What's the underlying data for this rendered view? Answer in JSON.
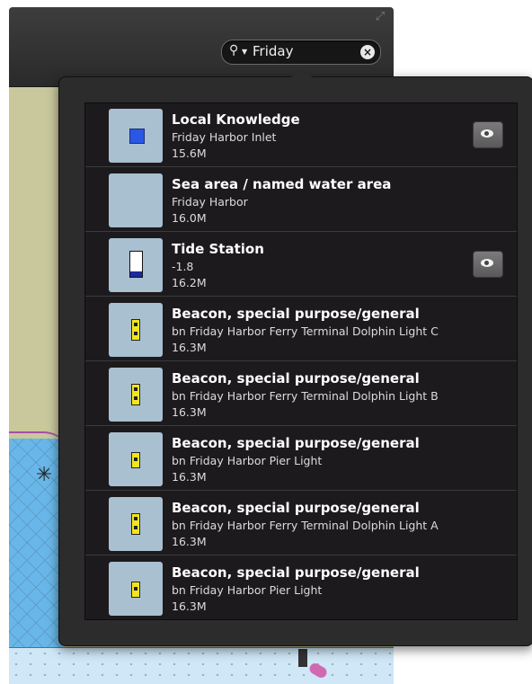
{
  "search": {
    "value": "Friday",
    "clear_icon": "clear-icon",
    "search_icon": "magnifier-icon"
  },
  "colors": {
    "popover_bg": "#2c2c2c",
    "list_bg": "#1d1a1d",
    "thumb_bg": "#a8c0d0",
    "beacon_yellow": "#f3e51d",
    "local_knowledge_blue": "#2a57e6"
  },
  "results": [
    {
      "title": "Local Knowledge",
      "subtitle": "Friday Harbor Inlet",
      "distance": "15.6M",
      "symbol": "blue-square-icon",
      "has_view_button": true
    },
    {
      "title": "Sea area / named water area",
      "subtitle": "Friday Harbor",
      "distance": "16.0M",
      "symbol": "blank",
      "has_view_button": false
    },
    {
      "title": "Tide Station",
      "subtitle": "-1.8",
      "distance": "16.2M",
      "symbol": "tide-gauge-icon",
      "has_view_button": true
    },
    {
      "title": "Beacon, special purpose/general",
      "subtitle": "bn Friday Harbor Ferry Terminal Dolphin Light C",
      "distance": "16.3M",
      "symbol": "beacon-icon",
      "has_view_button": false
    },
    {
      "title": "Beacon, special purpose/general",
      "subtitle": "bn Friday Harbor Ferry Terminal Dolphin Light B",
      "distance": "16.3M",
      "symbol": "beacon-icon",
      "has_view_button": false
    },
    {
      "title": "Beacon, special purpose/general",
      "subtitle": "bn Friday Harbor Pier Light",
      "distance": "16.3M",
      "symbol": "beacon-icon",
      "has_view_button": false
    },
    {
      "title": "Beacon, special purpose/general",
      "subtitle": "bn Friday Harbor Ferry Terminal Dolphin Light A",
      "distance": "16.3M",
      "symbol": "beacon-icon",
      "has_view_button": false
    },
    {
      "title": "Beacon, special purpose/general",
      "subtitle": "bn Friday Harbor Pier Light",
      "distance": "16.3M",
      "symbol": "beacon-icon",
      "has_view_button": false
    }
  ]
}
